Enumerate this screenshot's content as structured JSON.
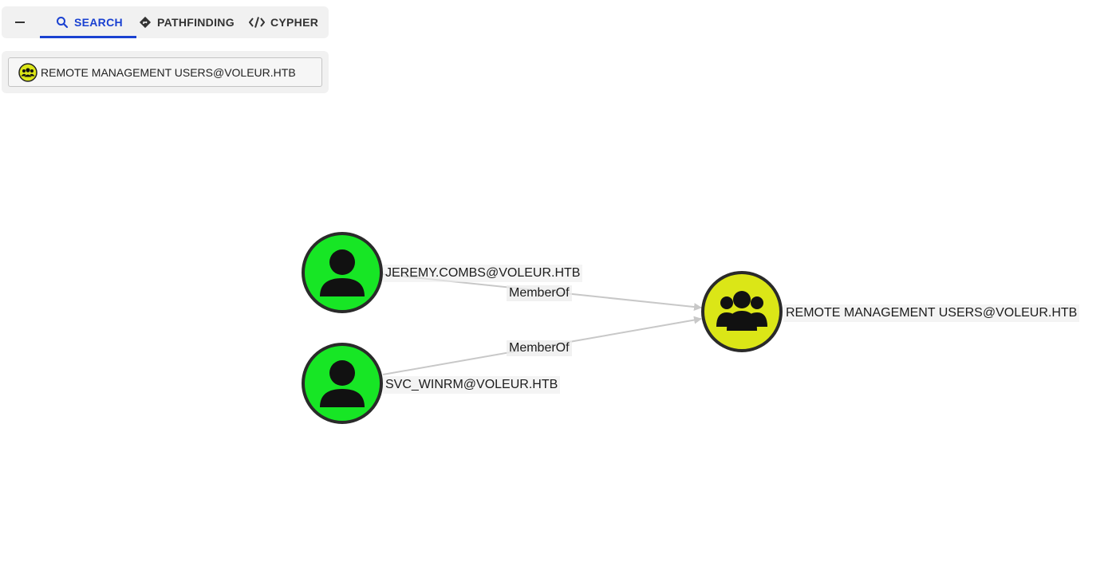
{
  "tabs": {
    "search_label": "SEARCH",
    "pathfinding_label": "PATHFINDING",
    "cypher_label": "CYPHER",
    "active": "search"
  },
  "search": {
    "value": "REMOTE MANAGEMENT USERS@VOLEUR.HTB",
    "icon": "group-icon"
  },
  "graph": {
    "nodes": [
      {
        "id": "jeremy",
        "label": "JEREMY.COMBS@VOLEUR.HTB",
        "type": "User",
        "icon": "user-icon",
        "color": "#17e625"
      },
      {
        "id": "svc",
        "label": "SVC_WINRM@VOLEUR.HTB",
        "type": "User",
        "icon": "user-icon",
        "color": "#17e625"
      },
      {
        "id": "rmu",
        "label": "REMOTE MANAGEMENT USERS@VOLEUR.HTB",
        "type": "Group",
        "icon": "group-icon",
        "color": "#dbe617"
      }
    ],
    "edges": [
      {
        "from": "jeremy",
        "to": "rmu",
        "label": "MemberOf"
      },
      {
        "from": "svc",
        "to": "rmu",
        "label": "MemberOf"
      }
    ]
  },
  "colors": {
    "accent": "#1a41d1",
    "user_node": "#17e625",
    "group_node": "#dbe617",
    "edge": "#c8c8c8"
  }
}
